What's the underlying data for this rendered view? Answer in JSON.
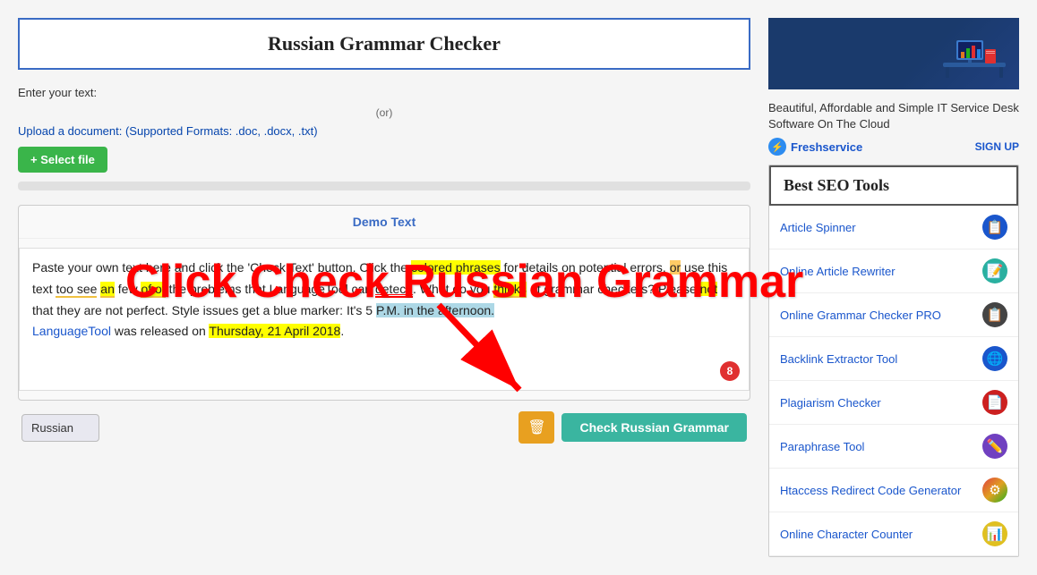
{
  "header": {
    "title": "Russian Grammar Checker"
  },
  "main": {
    "enter_text_label": "Enter your text:",
    "or_label": "(or)",
    "upload_label": "Upload a document: (Supported Formats: .doc, .docx, .txt)",
    "select_file_btn": "+ Select file",
    "demo_text_header": "Demo Text",
    "demo_text": "Paste your own text here and click the 'Check Text' button. Click the colored phrases for details on potential errors.",
    "language_label": "Russian",
    "trash_icon": "🗑",
    "check_btn": "Check Russian Grammar",
    "badge_count": "8",
    "overlay_text": "Click Check Russian Grammar"
  },
  "sidebar": {
    "ad_title": "Beautiful, Affordable and Simple IT Service Desk Software On The Cloud",
    "brand_name": "Freshservice",
    "signup_label": "SIGN UP",
    "seo_header": "Best SEO Tools",
    "seo_items": [
      {
        "label": "Article Spinner",
        "icon": "📋",
        "icon_class": "icon-blue"
      },
      {
        "label": "Online Article Rewriter",
        "icon": "📝",
        "icon_class": "icon-teal"
      },
      {
        "label": "Online Grammar Checker PRO",
        "icon": "📋",
        "icon_class": "icon-dark"
      },
      {
        "label": "Backlink Extractor Tool",
        "icon": "🌐",
        "icon_class": "icon-blue"
      },
      {
        "label": "Plagiarism Checker",
        "icon": "📄",
        "icon_class": "icon-red"
      },
      {
        "label": "Paraphrase Tool",
        "icon": "✏️",
        "icon_class": "icon-purple"
      },
      {
        "label": "Htaccess Redirect Code Generator",
        "icon": "⚙",
        "icon_class": "icon-rainbow"
      },
      {
        "label": "Online Character Counter",
        "icon": "📊",
        "icon_class": "icon-yellow"
      }
    ]
  }
}
